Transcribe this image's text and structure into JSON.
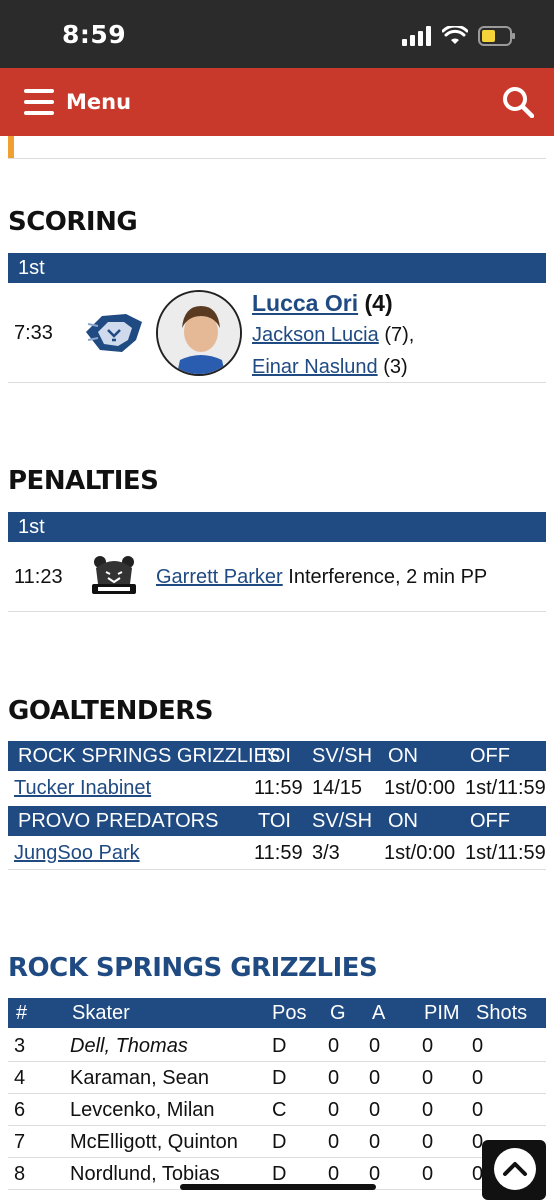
{
  "status_bar": {
    "time": "8:59"
  },
  "nav": {
    "menu_label": "Menu"
  },
  "scoring": {
    "title": "SCORING",
    "period": "1st",
    "goal": {
      "time": "7:33",
      "scorer": "Lucca Ori",
      "scorer_count": "(4)",
      "assist1": "Jackson Lucia",
      "assist1_count": "(7),",
      "assist2": "Einar Naslund",
      "assist2_count": "(3)"
    }
  },
  "penalties": {
    "title": "PENALTIES",
    "period": "1st",
    "penalty": {
      "time": "11:23",
      "player": "Garrett Parker",
      "description": "Interference, 2 min PP"
    }
  },
  "goaltenders": {
    "title": "GOALTENDERS",
    "columns": [
      "TOI",
      "SV/SH",
      "ON",
      "OFF"
    ],
    "teams": [
      {
        "name": "ROCK SPRINGS GRIZZLIES",
        "goalie": "Tucker Inabinet",
        "toi": "11:59",
        "svsh": "14/15",
        "on": "1st/0:00",
        "off": "1st/11:59"
      },
      {
        "name": "PROVO PREDATORS",
        "goalie": "JungSoo Park",
        "toi": "11:59",
        "svsh": "3/3",
        "on": "1st/0:00",
        "off": "1st/11:59"
      }
    ]
  },
  "skaters": {
    "team_title": "ROCK SPRINGS GRIZZLIES",
    "columns": [
      "#",
      "Skater",
      "Pos",
      "G",
      "A",
      "PIM",
      "Shots"
    ],
    "rows": [
      {
        "num": "3",
        "name": "Dell, Thomas",
        "pos": "D",
        "g": "0",
        "a": "0",
        "pim": "0",
        "shots": "0"
      },
      {
        "num": "4",
        "name": "Karaman, Sean",
        "pos": "D",
        "g": "0",
        "a": "0",
        "pim": "0",
        "shots": "0"
      },
      {
        "num": "6",
        "name": "Levcenko, Milan",
        "pos": "C",
        "g": "0",
        "a": "0",
        "pim": "0",
        "shots": "0"
      },
      {
        "num": "7",
        "name": "McElligott, Quinton",
        "pos": "D",
        "g": "0",
        "a": "0",
        "pim": "0",
        "shots": "0"
      },
      {
        "num": "8",
        "name": "Nordlund, Tobias",
        "pos": "D",
        "g": "0",
        "a": "0",
        "pim": "0",
        "shots": "0"
      }
    ]
  },
  "colors": {
    "nav": "#c9392b",
    "header_blue": "#1f4a82",
    "accent_orange": "#f0a030"
  },
  "icons": {
    "menu": "hamburger-icon",
    "search": "search-icon",
    "scroll_top": "chevron-up-icon"
  }
}
